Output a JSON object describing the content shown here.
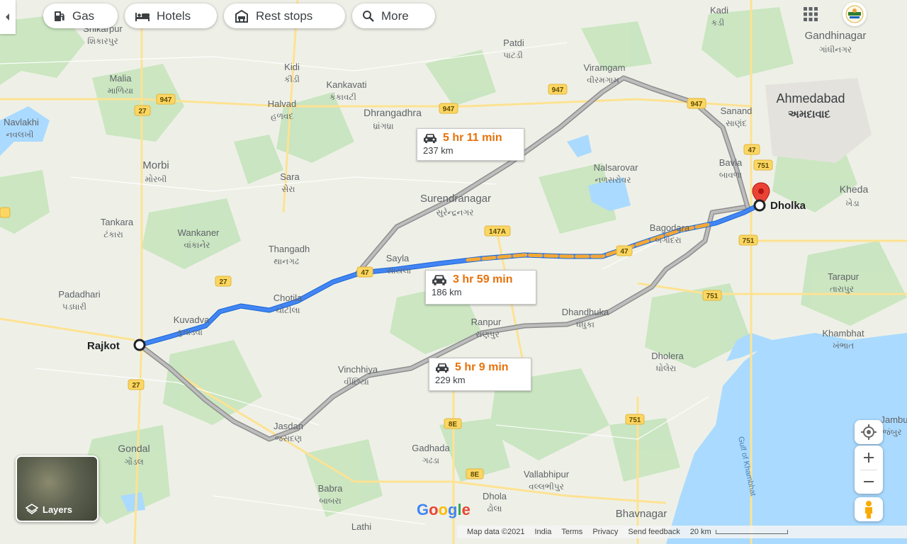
{
  "toolbar": {
    "gas_label": "Gas",
    "hotels_label": "Hotels",
    "rest_stops_label": "Rest stops",
    "more_label": "More"
  },
  "origin": {
    "name": "Rajkot"
  },
  "destination": {
    "name": "Dholka"
  },
  "routes": [
    {
      "id": "north",
      "time": "5 hr 11 min",
      "distance": "237 km"
    },
    {
      "id": "best",
      "time": "3 hr 59 min",
      "distance": "186 km"
    },
    {
      "id": "south",
      "time": "5 hr 9 min",
      "distance": "229 km"
    }
  ],
  "places": {
    "shikarpur": [
      "Shikarpur",
      "શિકારપુર"
    ],
    "malia": [
      "Malia",
      "માળિયા"
    ],
    "navlakhi": [
      "Navlakhi",
      "નવલખી"
    ],
    "morbi": [
      "Morbi",
      "મોરબી"
    ],
    "tankara": [
      "Tankara",
      "ટંકારા"
    ],
    "wankaner": [
      "Wankaner",
      "વાંકાનેર"
    ],
    "padadhari": [
      "Padadhari",
      "પડધારી"
    ],
    "kuvadva": [
      "Kuvadva",
      "કુવાડવા"
    ],
    "gondal": [
      "Gondal",
      "ગોંડલ"
    ],
    "kidi": [
      "Kidi",
      "કીડી"
    ],
    "kankavati": [
      "Kankavati",
      "કંકાવટી"
    ],
    "halvad": [
      "Halvad",
      "હળવદ"
    ],
    "dhrangadhra": [
      "Dhrangadhra",
      "ધ્રાંગધ્રા"
    ],
    "sara": [
      "Sara",
      "સેરા"
    ],
    "thangadh": [
      "Thangadh",
      "થાનગઢ"
    ],
    "chotila": [
      "Chotila",
      "ચોટીલા"
    ],
    "surendranagar": [
      "Surendranagar",
      "સુરેન્દ્રનગર"
    ],
    "sayla": [
      "Sayla",
      "સાયલા"
    ],
    "patdi": [
      "Patdi",
      "પાટડી"
    ],
    "viramgam": [
      "Viramgam",
      "વીરમગામ"
    ],
    "nalsarovar": [
      "Nalsarovar",
      "નળસરોવર"
    ],
    "kadi": [
      "Kadi",
      "કડી"
    ],
    "gandhinagar": [
      "Gandhinagar",
      "ગાંધીનગર"
    ],
    "ahmedabad": [
      "Ahmedabad",
      "અમદાવાદ"
    ],
    "sanand": [
      "Sanand",
      "સાણંદ"
    ],
    "bavla": [
      "Bavla",
      "બાવળા"
    ],
    "kheda": [
      "Kheda",
      "ખેડા"
    ],
    "bagodara": [
      "Bagodara",
      "બગોદરા"
    ],
    "tarapur": [
      "Tarapur",
      "તારાપુર"
    ],
    "dhandhuka": [
      "Dhandhuka",
      "ધંધુકા"
    ],
    "ranpur": [
      "Ranpur",
      "રાણપુર"
    ],
    "khambhat": [
      "Khambhat",
      "ખંભાત"
    ],
    "dholera": [
      "Dholera",
      "ધોલેરા"
    ],
    "vinchhiya": [
      "Vinchhiya",
      "વીંછિયા"
    ],
    "jasdan": [
      "Jasdan",
      "જસદણ"
    ],
    "gadhada": [
      "Gadhada",
      "ગઢડા"
    ],
    "vallabhipur": [
      "Vallabhipur",
      "વલ્લભીપુર"
    ],
    "babra": [
      "Babra",
      "બાબરા"
    ],
    "dhola": [
      "Dhola",
      "ઢોલા"
    ],
    "bhavnagar": [
      "Bhavnagar",
      ""
    ],
    "lathi": [
      "Lathi",
      ""
    ],
    "jambusar": [
      "Jambu",
      "જંબુર"
    ]
  },
  "road_shields": [
    "947",
    "947",
    "947",
    "947",
    "27",
    "27",
    "27",
    "47",
    "47",
    "47",
    "47",
    "751",
    "751",
    "751",
    "751",
    "147A",
    "8E",
    "8E",
    "27"
  ],
  "gulf_label": "Gulf of Khambhat",
  "google_logo": "Google",
  "layers_label": "Layers",
  "footer": {
    "map_data": "Map data ©2021",
    "country": "India",
    "terms": "Terms",
    "privacy": "Privacy",
    "feedback": "Send feedback",
    "scale": "20 km"
  },
  "colors": {
    "route_primary": "#4285f4",
    "route_traffic": "#f4a836",
    "route_alt": "#a9a9a9",
    "water": "#aadaff",
    "green": "#c2e3c0",
    "pin": "#ea4335"
  },
  "icons": {
    "gas": "gas-pump-icon",
    "hotels": "bed-icon",
    "rest_stops": "rest-stop-icon",
    "more": "search-icon"
  }
}
